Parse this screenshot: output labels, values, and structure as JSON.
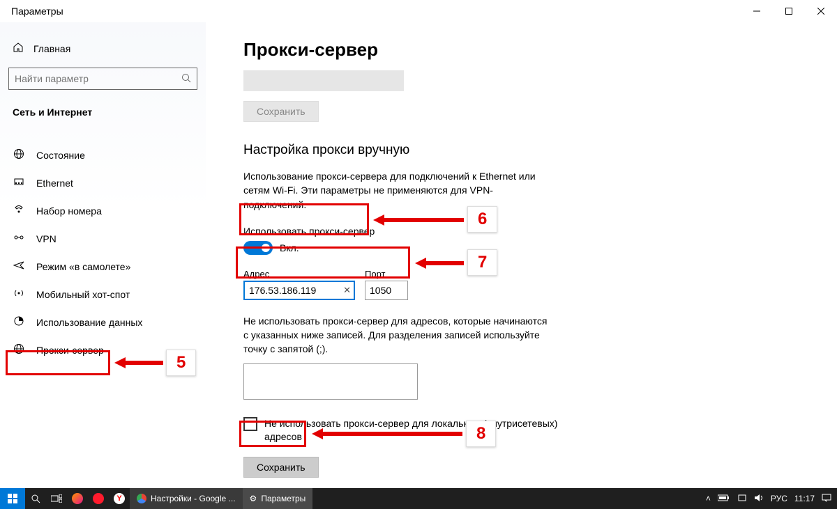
{
  "window": {
    "title": "Параметры"
  },
  "sidebar": {
    "home": "Главная",
    "search_placeholder": "Найти параметр",
    "section": "Сеть и Интернет",
    "items": [
      {
        "label": "Состояние",
        "icon": "globe"
      },
      {
        "label": "Ethernet",
        "icon": "ethernet"
      },
      {
        "label": "Набор номера",
        "icon": "dialup"
      },
      {
        "label": "VPN",
        "icon": "vpn"
      },
      {
        "label": "Режим «в самолете»",
        "icon": "airplane"
      },
      {
        "label": "Мобильный хот-спот",
        "icon": "hotspot"
      },
      {
        "label": "Использование данных",
        "icon": "data"
      },
      {
        "label": "Прокси-сервер",
        "icon": "proxy"
      }
    ]
  },
  "main": {
    "title": "Прокси-сервер",
    "save_disabled_label": "Сохранить",
    "manual_heading": "Настройка прокси вручную",
    "manual_desc": "Использование прокси-сервера для подключений к Ethernet или сетям Wi-Fi. Эти параметры не применяются для VPN-подключений.",
    "use_proxy_label": "Использовать прокси-сервер",
    "toggle_state": "Вкл.",
    "address_label": "Адрес",
    "address_value": "176.53.186.119",
    "port_label": "Порт",
    "port_value": "1050",
    "bypass_desc": "Не использовать прокси-сервер для адресов, которые начинаются с указанных ниже записей. Для разделения записей используйте точку с запятой (;).",
    "bypass_value": "",
    "local_checkbox_label": "Не использовать прокси-сервер для локальных (внутрисетевых) адресов",
    "save_label": "Сохранить"
  },
  "taskbar": {
    "task1": "Настройки - Google ...",
    "task2": "Параметры",
    "lang": "РУС",
    "time": "11:17"
  },
  "annotations": {
    "n5": "5",
    "n6": "6",
    "n7": "7",
    "n8": "8"
  }
}
